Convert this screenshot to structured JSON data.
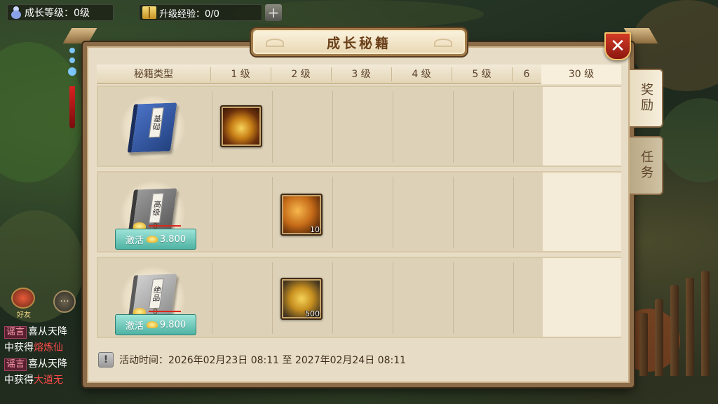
{
  "hud": {
    "level_text": "成长等级：0级",
    "exp_text": "升级经验：0/0",
    "plus_label": "+"
  },
  "dialog": {
    "title": "成长秘籍",
    "close_label": "✕",
    "header": {
      "type_col": "秘籍类型",
      "levels": [
        "1 级",
        "2 级",
        "3 级",
        "4 级",
        "5 级",
        "6"
      ],
      "last_level": "30 级"
    },
    "rows": [
      {
        "book_label": "基础",
        "book_color": "blue",
        "rewards": [
          {
            "level_index": 0,
            "icon": "treasure-chest-icon",
            "qty": ""
          }
        ]
      },
      {
        "book_label": "高级",
        "book_color": "grey",
        "price_strike": "0",
        "activate_label": "激活",
        "activate_price": "3.800",
        "rewards": [
          {
            "level_index": 1,
            "icon": "gold-orb-icon",
            "qty": "10"
          }
        ]
      },
      {
        "book_label": "绝品",
        "book_color": "silver",
        "price_strike": "0",
        "activate_label": "激活",
        "activate_price": "9.800",
        "rewards": [
          {
            "level_index": 1,
            "icon": "gold-medal-icon",
            "qty": "500"
          }
        ]
      }
    ],
    "tabs": [
      {
        "label": "奖励",
        "active": true
      },
      {
        "label": "任务",
        "active": false
      }
    ],
    "footer": {
      "time_text": "活动时间：2026年02月23日 08:11 至 2027年02月24日 08:11",
      "warn_glyph": "!"
    }
  },
  "side": {
    "friend_label": "好友",
    "chat_glyph": "···"
  },
  "chat": [
    {
      "tag": "谣言",
      "text": "喜从天降"
    },
    {
      "prefix": "中获得",
      "red": "熔炼仙"
    },
    {
      "tag": "谣言",
      "text": "喜从天降"
    },
    {
      "prefix": "中获得",
      "red": "大道无"
    }
  ],
  "colors": {
    "accent_gold": "#c79224",
    "close_red": "#d23a26",
    "activate_teal": "#4fb3a3",
    "strike_red": "#d8281c"
  }
}
